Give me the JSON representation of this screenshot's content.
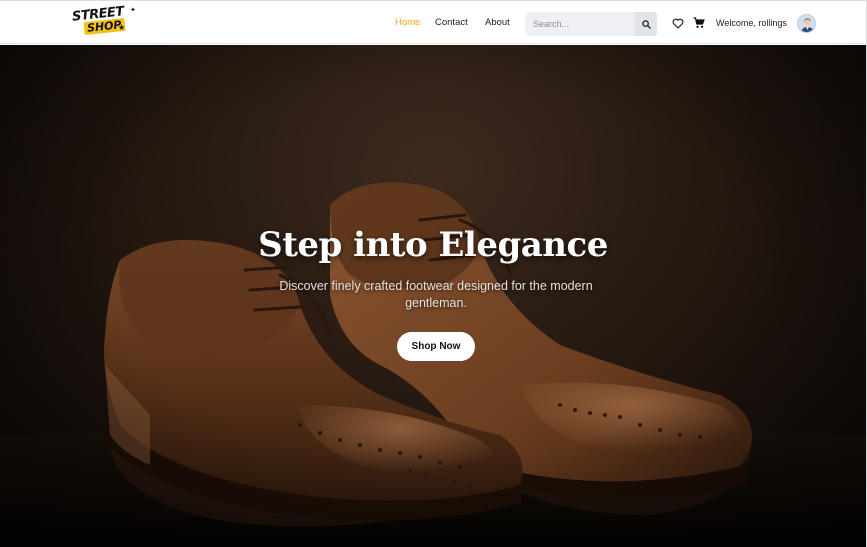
{
  "brand": {
    "logo_line1": "STREET",
    "logo_line2": "SHOP",
    "accent": "#f5a623",
    "logo_badge_color": "#f2c418"
  },
  "nav": {
    "links": [
      {
        "label": "Home",
        "active": true
      },
      {
        "label": "Contact",
        "active": false
      },
      {
        "label": "About",
        "active": false
      }
    ]
  },
  "search": {
    "placeholder": "Search...",
    "icon": "search-icon"
  },
  "header_icons": {
    "wishlist": "heart-icon",
    "cart": "cart-icon"
  },
  "user": {
    "welcome_text": "Welcome, rollings",
    "avatar": "user-avatar"
  },
  "hero": {
    "title": "Step into Elegance",
    "subtitle": "Discover finely crafted footwear designed for the modern gentleman.",
    "cta_label": "Shop Now",
    "image": "brown-leather-brogue-shoes"
  }
}
